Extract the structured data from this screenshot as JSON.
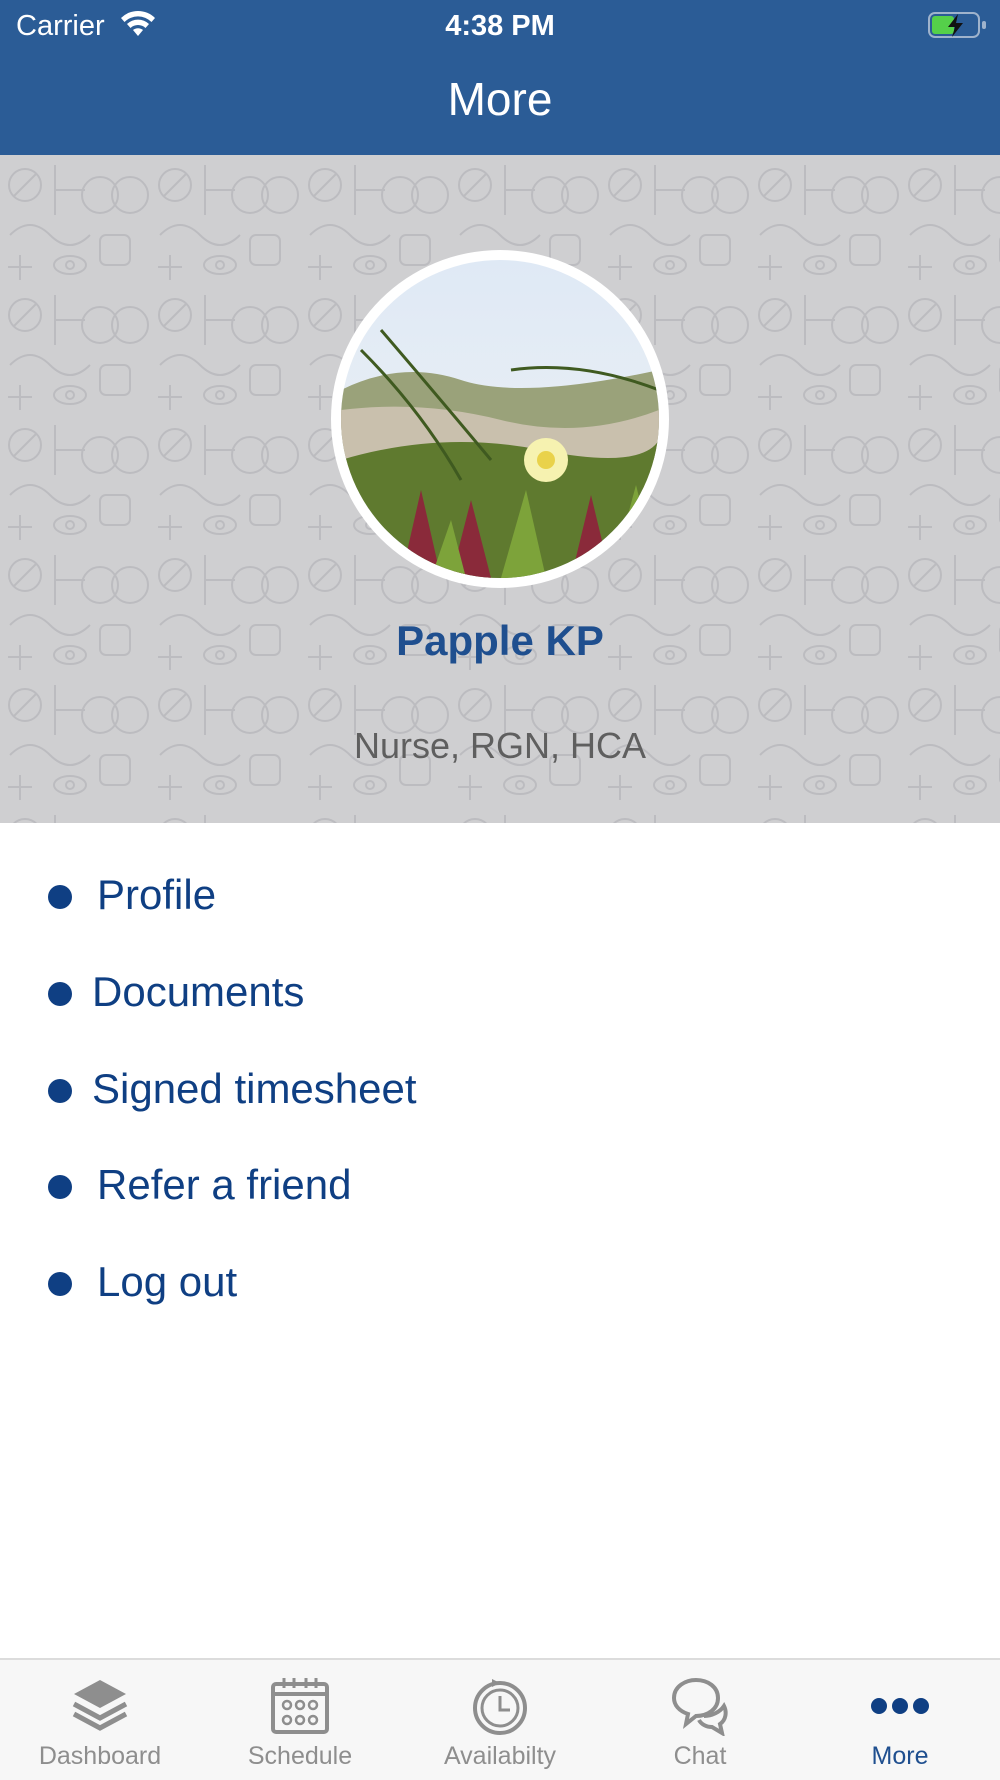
{
  "status_bar": {
    "carrier": "Carrier",
    "time": "4:38 PM"
  },
  "header": {
    "title": "More"
  },
  "profile": {
    "name": "Papple KP",
    "role": "Nurse, RGN, HCA",
    "avatar_icon": "profile-photo"
  },
  "menu": {
    "items": [
      {
        "label": "Profile"
      },
      {
        "label": "Documents"
      },
      {
        "label": "Signed timesheet"
      },
      {
        "label": "Refer a friend"
      },
      {
        "label": "Log out"
      }
    ]
  },
  "tabbar": {
    "tabs": [
      {
        "label": "Dashboard",
        "icon": "layers-icon"
      },
      {
        "label": "Schedule",
        "icon": "calendar-icon"
      },
      {
        "label": "Availabilty",
        "icon": "clock-icon"
      },
      {
        "label": "Chat",
        "icon": "chat-bubbles-icon"
      },
      {
        "label": "More",
        "icon": "more-dots-icon",
        "active": true
      }
    ]
  },
  "colors": {
    "header_bg": "#2b5c96",
    "accent": "#0f3f83",
    "hero_bg": "#cfcfd1",
    "inactive_tab": "#8e8e8e"
  }
}
